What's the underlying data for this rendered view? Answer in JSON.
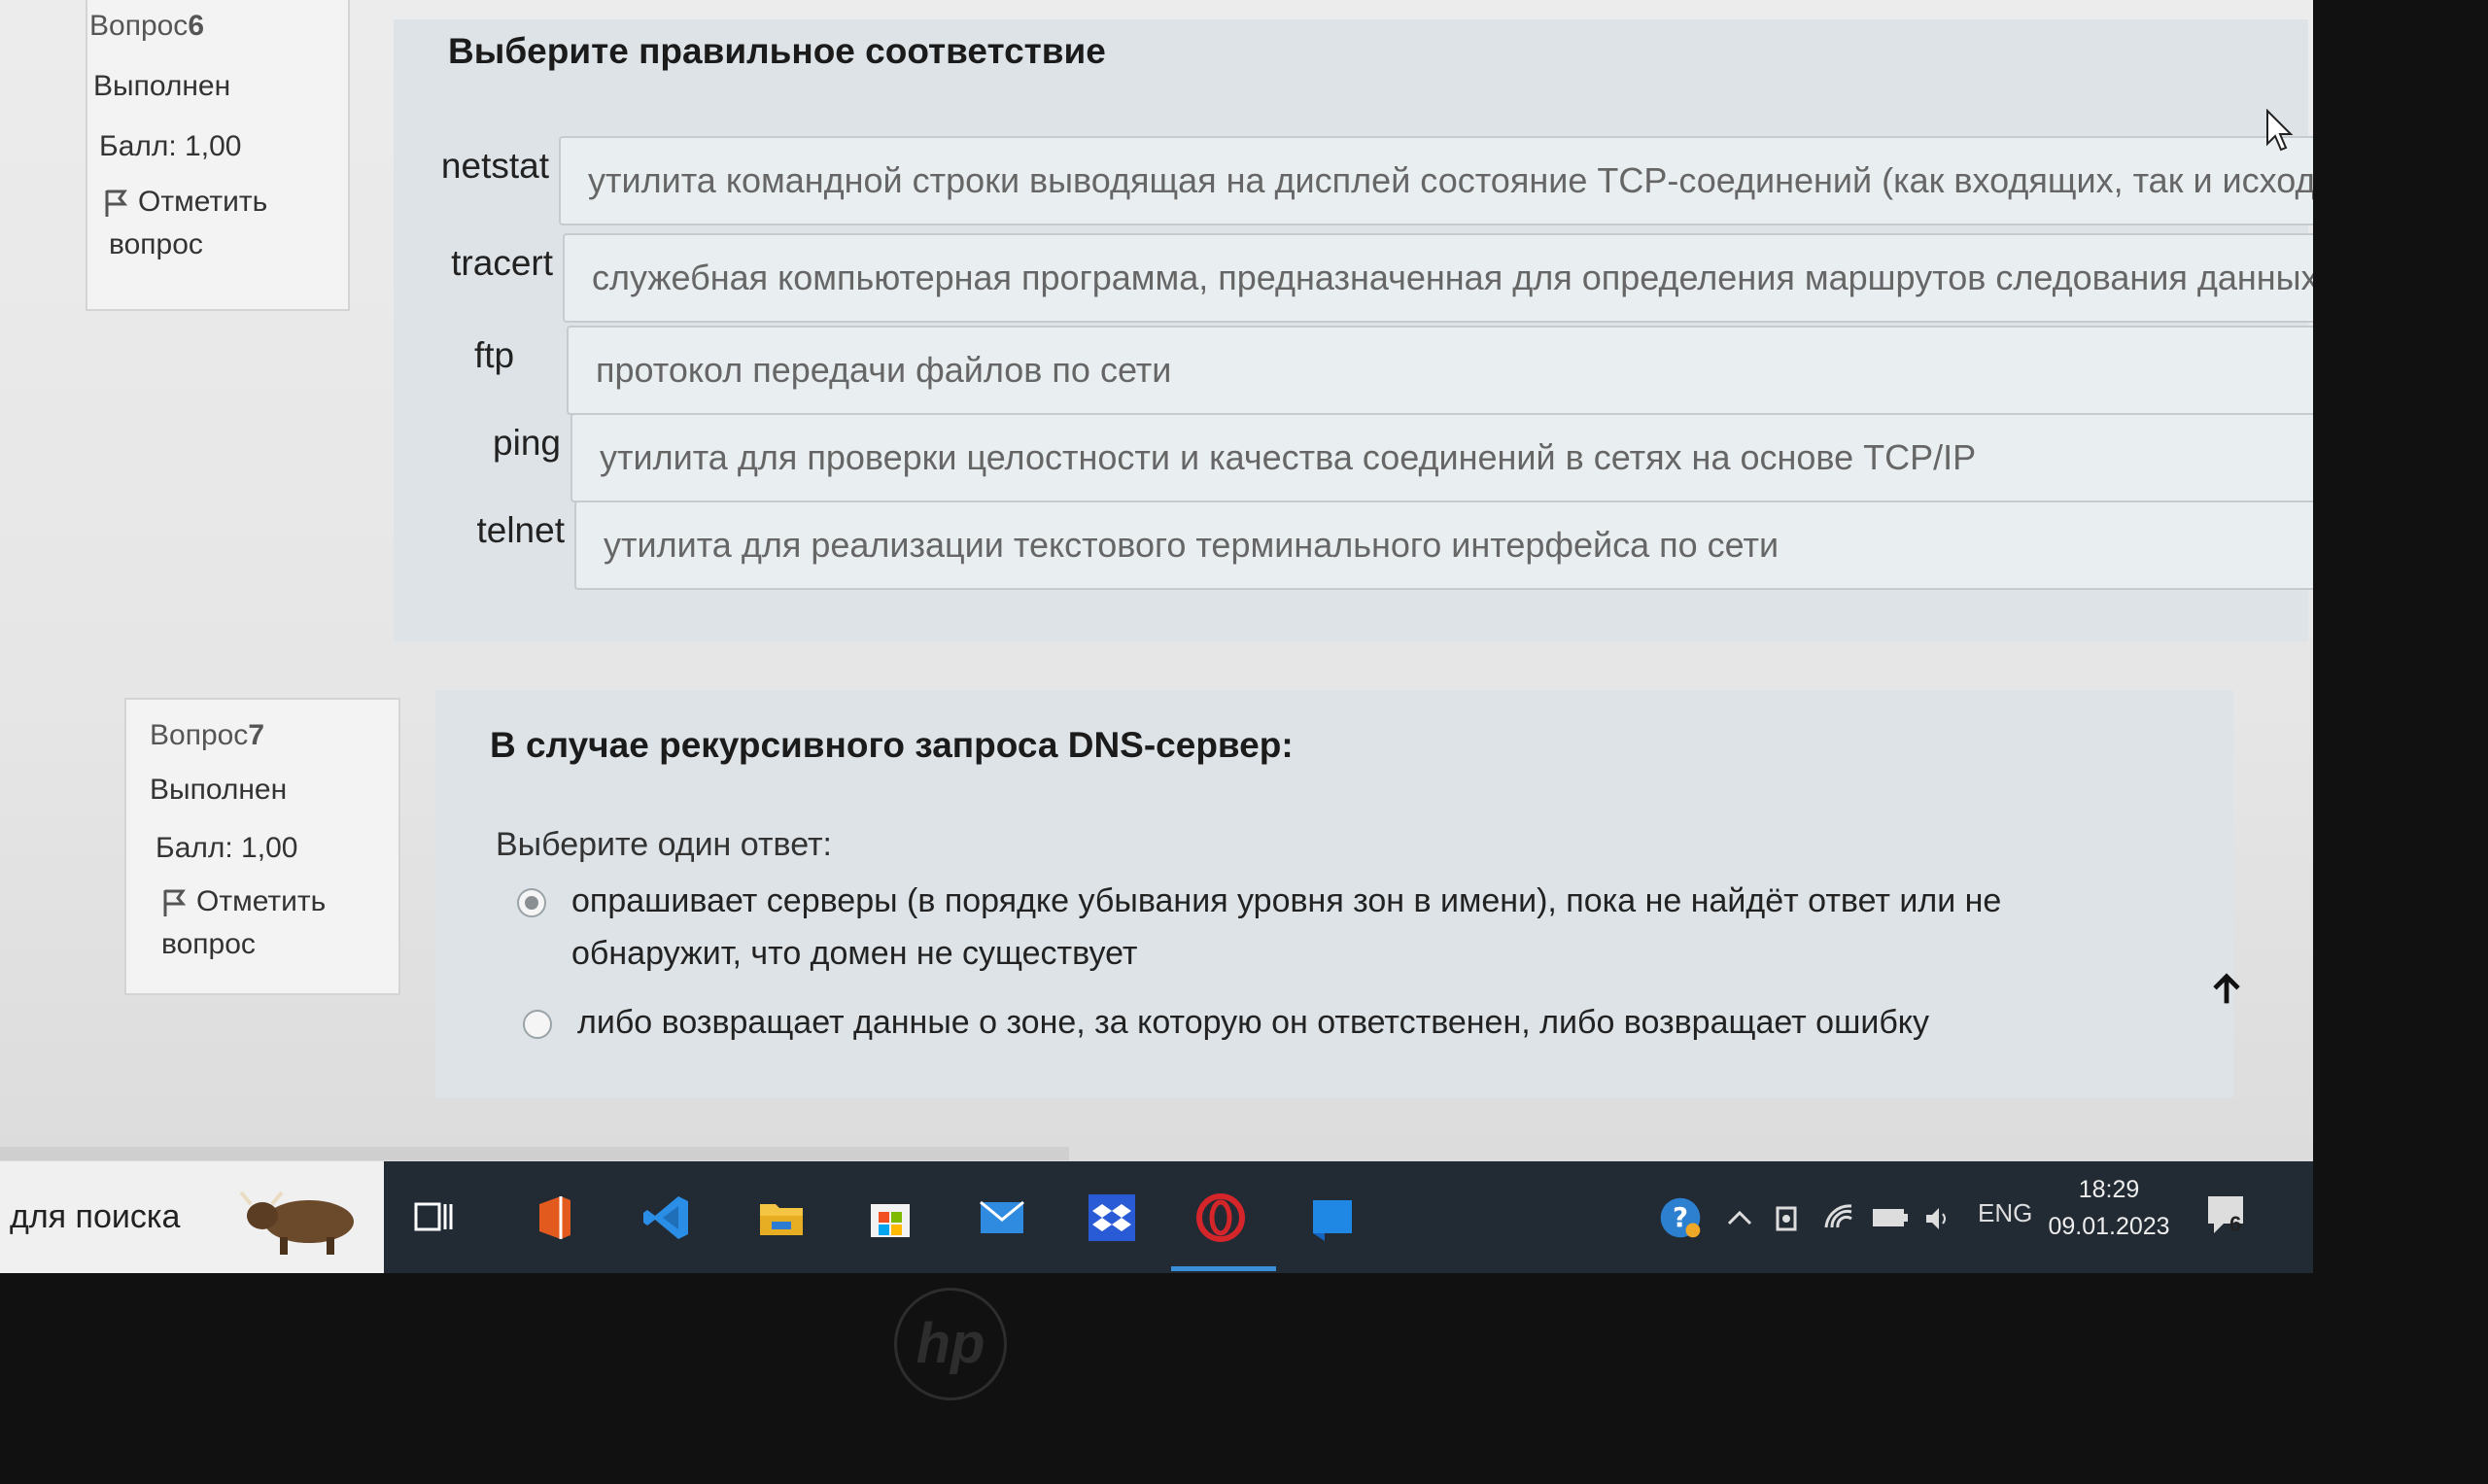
{
  "question6": {
    "number_label": "Вопрос",
    "number": "6",
    "status": "Выполнен",
    "score": "Балл: 1,00",
    "flag_label_1": "Отметить",
    "flag_label_2": "вопрос",
    "title": "Выберите правильное соответствие",
    "pairs": [
      {
        "term": "netstat",
        "answer": "утилита командной строки выводящая на дисплей состояние TCP-соединений (как входящих, так и исходящ"
      },
      {
        "term": "tracert",
        "answer": "служебная компьютерная программа, предназначенная для определения маршрутов следования данных в"
      },
      {
        "term": "ftp",
        "answer": "протокол передачи файлов по сети"
      },
      {
        "term": "ping",
        "answer": "утилита для проверки целостности и качества соединений в сетях на основе TCP/IP"
      },
      {
        "term": "telnet",
        "answer": "утилита для реализации текстового терминального интерфейса по сети"
      }
    ]
  },
  "question7": {
    "number_label": "Вопрос",
    "number": "7",
    "status": "Выполнен",
    "score": "Балл: 1,00",
    "flag_label_1": "Отметить",
    "flag_label_2": "вопрос",
    "title": "В случае рекурсивного запроса DNS-сервер:",
    "prompt": "Выберите один ответ:",
    "options": [
      {
        "line1": "опрашивает серверы (в порядке убывания уровня зон в имени), пока не найдёт ответ или не",
        "line2": "обнаружит, что домен не существует",
        "selected": true
      },
      {
        "line1": "либо возвращает данные о зоне, за которую он ответственен, либо возвращает ошибку",
        "line2": "",
        "selected": false
      }
    ]
  },
  "taskbar": {
    "search_text": "для поиска",
    "language": "ENG",
    "time": "18:29",
    "date": "09.01.2023",
    "notification_count": "6",
    "icons": [
      "task-view-icon",
      "office-icon",
      "vscode-icon",
      "file-explorer-icon",
      "microsoft-store-icon",
      "mail-icon",
      "dropbox-icon",
      "opera-icon",
      "blue-app-icon"
    ]
  },
  "bezel": {
    "logo": "hp"
  },
  "colors": {
    "taskbar": "#222a33",
    "card": "#dde3e6",
    "opera_red": "#d4252b",
    "active_underline": "#3b8fd8"
  }
}
